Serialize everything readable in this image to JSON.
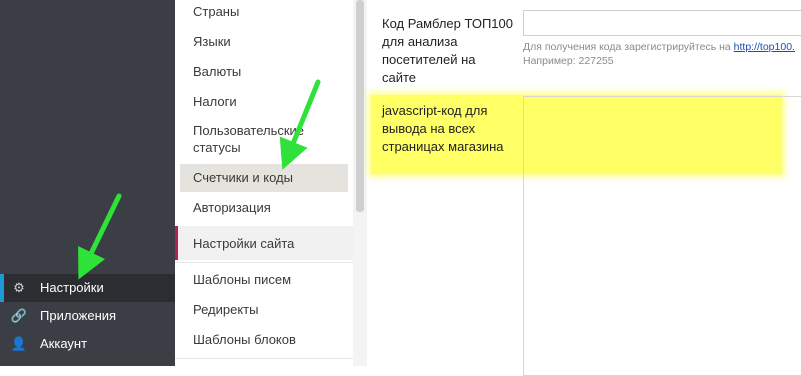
{
  "sidebar": {
    "items": [
      {
        "label": "Настройки",
        "icon": "gear-icon",
        "active": true
      },
      {
        "label": "Приложения",
        "icon": "link-icon"
      },
      {
        "label": "Аккаунт",
        "icon": "user-icon"
      }
    ]
  },
  "submenu": {
    "items": [
      "Страны",
      "Языки",
      "Валюты",
      "Налоги",
      "Пользовательские",
      "статусы",
      "Счетчики и коды",
      "Авторизация",
      "Настройки сайта",
      "Шаблоны писем",
      "Редиректы",
      "Шаблоны блоков"
    ]
  },
  "form": {
    "rambler_label": [
      "Код Рамблер ТОП100",
      "для анализа",
      "посетителей на",
      "сайте"
    ],
    "rambler_hint_prefix": "Для получения кода зарегистрируйтесь на ",
    "rambler_hint_link": "http://top100.",
    "rambler_example": "Например: 227255",
    "js_label": [
      "javascript-код для",
      "вывода на всех",
      "страницах магазина"
    ]
  },
  "colors": {
    "sidebar_bg": "#3b3e44",
    "active_marker": "#1e9bd7",
    "section_marker": "#b0234b",
    "highlight": "#ffff66",
    "arrow": "#2fe23a"
  }
}
